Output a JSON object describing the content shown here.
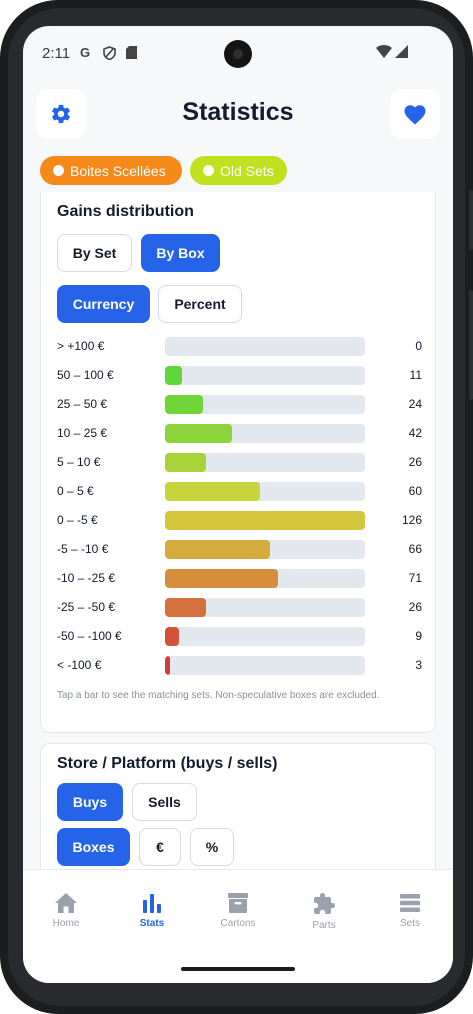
{
  "status_bar": {
    "time": "2:11",
    "icons": [
      "google-icon",
      "shield-icon",
      "sim-card-icon"
    ],
    "right_icons": [
      "wifi-icon",
      "cell-signal-icon"
    ]
  },
  "header": {
    "title": "Statistics",
    "left_icon": "gear-icon",
    "right_icon": "heart-icon",
    "accent": "#2563e8"
  },
  "chips": [
    {
      "label": "Boites Scellées",
      "color": "#f5891a",
      "text_color": "#ffffff"
    },
    {
      "label": "Old Sets",
      "color": "#bfe11f",
      "text_color": "#ffffff"
    }
  ],
  "gains": {
    "title": "Gains distribution",
    "group_toggle": [
      {
        "label": "By Set",
        "active": false
      },
      {
        "label": "By Box",
        "active": true
      }
    ],
    "unit_toggle": [
      {
        "label": "Currency",
        "active": true
      },
      {
        "label": "Percent",
        "active": false
      }
    ],
    "max": 126,
    "rows": [
      {
        "label": "> +100 €",
        "count": "0",
        "value": 0,
        "color": "#5fd63a"
      },
      {
        "label": "50 – 100 €",
        "count": "11",
        "value": 11,
        "color": "#5fd63a"
      },
      {
        "label": "25 – 50 €",
        "count": "24",
        "value": 24,
        "color": "#6fd539"
      },
      {
        "label": "10 – 25 €",
        "count": "42",
        "value": 42,
        "color": "#8bd43b"
      },
      {
        "label": "5 – 10 €",
        "count": "26",
        "value": 26,
        "color": "#a8d23a"
      },
      {
        "label": "0 – 5 €",
        "count": "60",
        "value": 60,
        "color": "#c7d43b"
      },
      {
        "label": "0 – -5 €",
        "count": "126",
        "value": 126,
        "color": "#d4c63c"
      },
      {
        "label": "-5 – -10 €",
        "count": "66",
        "value": 66,
        "color": "#d4ab3c"
      },
      {
        "label": "-10 – -25 €",
        "count": "71",
        "value": 71,
        "color": "#d48e3c"
      },
      {
        "label": "-25 – -50 €",
        "count": "26",
        "value": 26,
        "color": "#d4703c"
      },
      {
        "label": "-50 – -100 €",
        "count": "9",
        "value": 9,
        "color": "#d4523c"
      },
      {
        "label": "< -100 €",
        "count": "3",
        "value": 3,
        "color": "#d43c3c"
      }
    ],
    "note": "Tap a bar to see the matching sets. Non-speculative boxes are excluded."
  },
  "store": {
    "title": "Store / Platform (buys / sells)",
    "mode_toggle": [
      {
        "label": "Buys",
        "active": true
      },
      {
        "label": "Sells",
        "active": false
      }
    ],
    "metric_toggle": [
      {
        "label": "Boxes",
        "active": true
      },
      {
        "label": "€",
        "active": false
      },
      {
        "label": "%",
        "active": false
      }
    ]
  },
  "bottom_nav": [
    {
      "label": "Home",
      "icon": "home-icon",
      "active": false
    },
    {
      "label": "Stats",
      "icon": "bar-chart-icon",
      "active": true
    },
    {
      "label": "Cartons",
      "icon": "archive-box-icon",
      "active": false
    },
    {
      "label": "Parts",
      "icon": "puzzle-icon",
      "active": false
    },
    {
      "label": "Sets",
      "icon": "list-icon",
      "active": false
    }
  ]
}
